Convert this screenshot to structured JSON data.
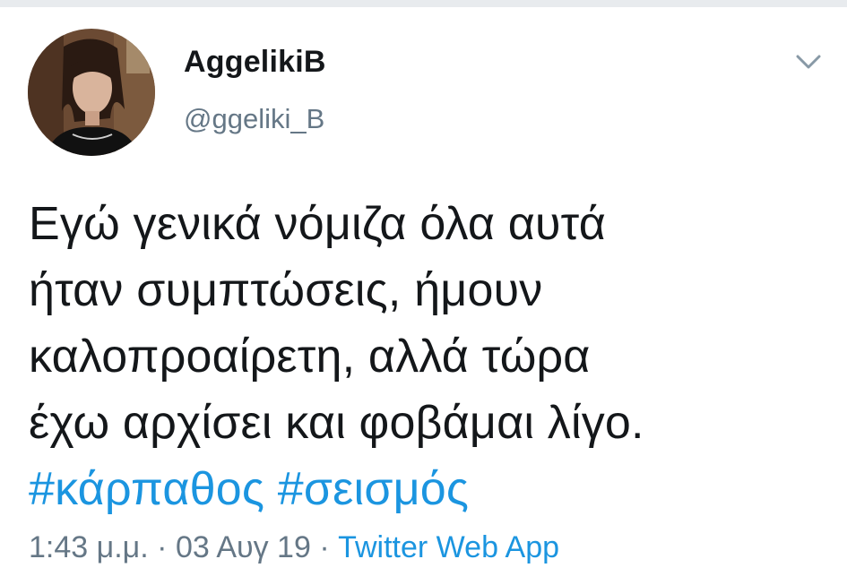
{
  "tweet": {
    "author": {
      "display_name": "AggelikiB",
      "handle": "@ggeliki_B"
    },
    "text_lines": [
      "Εγώ γενικά νόμιζα όλα αυτά",
      "ήταν συμπτώσεις, ήμουν",
      "καλοπροαίρετη, αλλά τώρα",
      "έχω αρχίσει και φοβάμαι λίγο."
    ],
    "hashtags": [
      "#κάρπαθος",
      "#σεισμός"
    ],
    "time": "1:43 μ.μ.",
    "separator": "·",
    "date": "03 Αυγ 19",
    "source": "Twitter Web App"
  },
  "colors": {
    "link": "#1b95e0",
    "secondary_text": "#657786",
    "primary_text": "#14171a"
  },
  "icons": {
    "menu": "chevron-down-icon"
  }
}
